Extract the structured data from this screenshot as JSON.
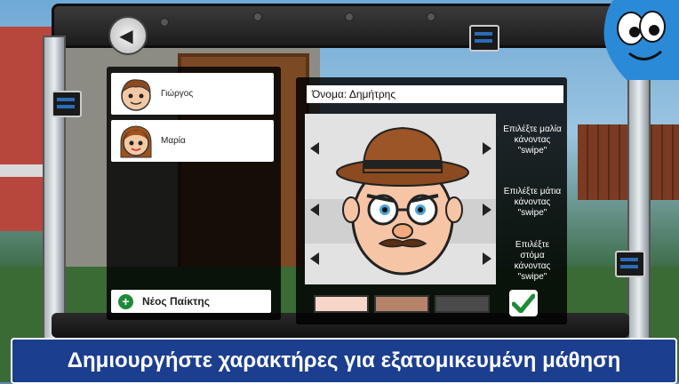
{
  "header": {
    "back_icon": "back-arrow-icon"
  },
  "players": [
    {
      "name": "Γιώργος",
      "avatar": "boy-avatar-icon"
    },
    {
      "name": "Μαρία",
      "avatar": "girl-avatar-icon"
    }
  ],
  "new_player_label": "Νέος Παίκτης",
  "character": {
    "name_label": "Όνομα: Δημήτρης",
    "hints": {
      "hair": "Επιλέξτε μαλία κάνοντας \"swipe\"",
      "eyes": "Επιλέξτε μάτια κάνοντας \"swipe\"",
      "mouth": "Επιλέξτε στόμα κάνοντας \"swipe\""
    },
    "skin_colors": [
      "#f6d6c8",
      "#b4836a",
      "#4a4a4a"
    ],
    "confirm_icon": "checkmark-icon"
  },
  "caption": "Δημιουργήστε χαρακτήρες για εξατομικευμένη μάθηση",
  "colors": {
    "accent": "#1f8a3a",
    "caption_bg": "#1c3e8f"
  }
}
